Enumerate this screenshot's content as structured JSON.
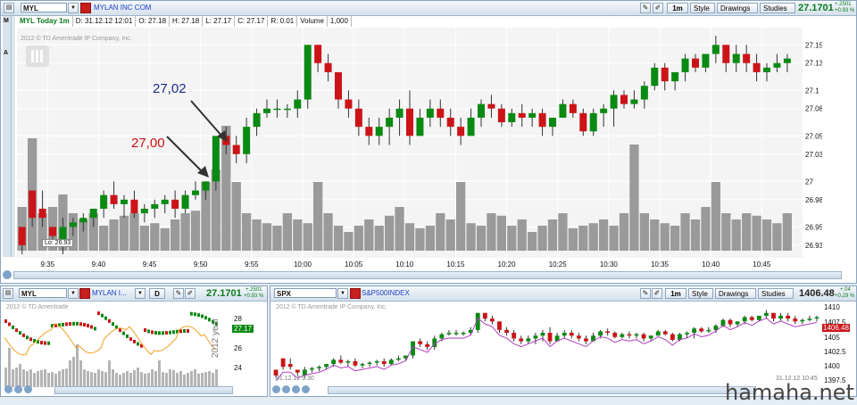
{
  "main": {
    "symbol": "MYL",
    "company_link": "MYLAN INC COM",
    "buttons": {
      "period": "1m",
      "style": "Style",
      "drawings": "Drawings",
      "studies": "Studies"
    },
    "last_price": "27.1701",
    "change_top": "+.2501",
    "change_bottom": "+0.93 %",
    "info": {
      "title": "MYL Today 1m",
      "date": "D: 31.12.12 12:01",
      "open": "O: 27.18",
      "high": "H: 27.18",
      "low": "L: 27.17",
      "close": "C: 27.17",
      "range": "R: 0.01",
      "volume_label": "Volume",
      "volume_value": "1,000"
    },
    "copyright": "2012 © TD Ameritrade IP Company, Inc.",
    "lo_label": "Lo: 26.93",
    "annotations": {
      "upper": "27,02",
      "lower": "27,00"
    },
    "side_letters": [
      "M",
      "A"
    ]
  },
  "chart_data": {
    "type": "candlestick",
    "title": "MYL Today 1m",
    "x_ticks": [
      "9:35",
      "9:40",
      "9:45",
      "9:50",
      "9:55",
      "10:00",
      "10:05",
      "10:10",
      "10:15",
      "10:20",
      "10:25",
      "10:30",
      "10:35",
      "10:40",
      "10:45"
    ],
    "y_ticks": [
      "27.15",
      "27.13",
      "27.1",
      "27.08",
      "27.05",
      "27.03",
      "27",
      "26.98",
      "26.95",
      "26.93"
    ],
    "y_range": [
      26.92,
      27.165
    ],
    "candles_ohlc": [
      [
        26.95,
        26.95,
        26.92,
        26.93
      ],
      [
        26.99,
        26.99,
        26.95,
        26.96
      ],
      [
        26.97,
        26.99,
        26.95,
        26.96
      ],
      [
        26.95,
        26.95,
        26.93,
        26.94
      ],
      [
        26.93,
        26.96,
        26.92,
        26.95
      ],
      [
        26.95,
        26.96,
        26.94,
        26.955
      ],
      [
        26.955,
        26.965,
        26.945,
        26.96
      ],
      [
        26.96,
        26.97,
        26.95,
        26.97
      ],
      [
        26.97,
        26.99,
        26.96,
        26.985
      ],
      [
        26.985,
        27.0,
        26.97,
        26.975
      ],
      [
        26.975,
        26.985,
        26.96,
        26.98
      ],
      [
        26.98,
        26.99,
        26.96,
        26.965
      ],
      [
        26.965,
        26.975,
        26.955,
        26.97
      ],
      [
        26.97,
        26.98,
        26.96,
        26.975
      ],
      [
        26.975,
        26.985,
        26.965,
        26.98
      ],
      [
        26.98,
        26.99,
        26.96,
        26.97
      ],
      [
        26.97,
        26.99,
        26.965,
        26.985
      ],
      [
        26.985,
        27.0,
        26.98,
        26.99
      ],
      [
        26.99,
        27.0,
        26.98,
        27.0
      ],
      [
        27.0,
        27.02,
        26.99,
        27.05
      ],
      [
        27.05,
        27.06,
        27.03,
        27.04
      ],
      [
        27.04,
        27.05,
        27.02,
        27.03
      ],
      [
        27.03,
        27.07,
        27.02,
        27.06
      ],
      [
        27.06,
        27.08,
        27.05,
        27.075
      ],
      [
        27.075,
        27.09,
        27.07,
        27.08
      ],
      [
        27.08,
        27.09,
        27.07,
        27.08
      ],
      [
        27.08,
        27.085,
        27.07,
        27.08
      ],
      [
        27.08,
        27.1,
        27.07,
        27.09
      ],
      [
        27.09,
        27.15,
        27.08,
        27.15
      ],
      [
        27.15,
        27.15,
        27.12,
        27.13
      ],
      [
        27.13,
        27.14,
        27.11,
        27.12
      ],
      [
        27.12,
        27.12,
        27.08,
        27.09
      ],
      [
        27.09,
        27.1,
        27.07,
        27.08
      ],
      [
        27.08,
        27.09,
        27.05,
        27.06
      ],
      [
        27.06,
        27.07,
        27.04,
        27.05
      ],
      [
        27.05,
        27.07,
        27.04,
        27.06
      ],
      [
        27.06,
        27.08,
        27.04,
        27.07
      ],
      [
        27.07,
        27.09,
        27.05,
        27.08
      ],
      [
        27.08,
        27.1,
        27.04,
        27.05
      ],
      [
        27.05,
        27.08,
        27.05,
        27.07
      ],
      [
        27.07,
        27.09,
        27.06,
        27.08
      ],
      [
        27.08,
        27.09,
        27.06,
        27.07
      ],
      [
        27.07,
        27.08,
        27.05,
        27.06
      ],
      [
        27.06,
        27.07,
        27.04,
        27.05
      ],
      [
        27.05,
        27.08,
        27.05,
        27.07
      ],
      [
        27.07,
        27.09,
        27.06,
        27.085
      ],
      [
        27.085,
        27.095,
        27.07,
        27.08
      ],
      [
        27.08,
        27.085,
        27.06,
        27.065
      ],
      [
        27.065,
        27.08,
        27.06,
        27.075
      ],
      [
        27.075,
        27.085,
        27.06,
        27.07
      ],
      [
        27.07,
        27.08,
        27.06,
        27.075
      ],
      [
        27.075,
        27.08,
        27.05,
        27.06
      ],
      [
        27.06,
        27.07,
        27.05,
        27.07
      ],
      [
        27.07,
        27.09,
        27.07,
        27.085
      ],
      [
        27.085,
        27.09,
        27.07,
        27.075
      ],
      [
        27.075,
        27.08,
        27.05,
        27.055
      ],
      [
        27.055,
        27.08,
        27.05,
        27.075
      ],
      [
        27.075,
        27.085,
        27.06,
        27.08
      ],
      [
        27.08,
        27.1,
        27.06,
        27.095
      ],
      [
        27.095,
        27.1,
        27.08,
        27.085
      ],
      [
        27.085,
        27.1,
        27.08,
        27.09
      ],
      [
        27.09,
        27.11,
        27.08,
        27.105
      ],
      [
        27.105,
        27.13,
        27.1,
        27.125
      ],
      [
        27.125,
        27.13,
        27.1,
        27.11
      ],
      [
        27.11,
        27.12,
        27.1,
        27.12
      ],
      [
        27.12,
        27.14,
        27.11,
        27.135
      ],
      [
        27.135,
        27.14,
        27.12,
        27.125
      ],
      [
        27.125,
        27.14,
        27.12,
        27.14
      ],
      [
        27.14,
        27.16,
        27.13,
        27.15
      ],
      [
        27.15,
        27.15,
        27.12,
        27.13
      ],
      [
        27.13,
        27.15,
        27.12,
        27.14
      ],
      [
        27.14,
        27.15,
        27.12,
        27.13
      ],
      [
        27.13,
        27.14,
        27.11,
        27.12
      ],
      [
        27.12,
        27.13,
        27.11,
        27.125
      ],
      [
        27.125,
        27.14,
        27.12,
        27.13
      ],
      [
        27.13,
        27.14,
        27.12,
        27.135
      ]
    ],
    "volume_relative": [
      0.35,
      0.9,
      0.3,
      0.35,
      0.45,
      0.3,
      0.25,
      0.3,
      0.2,
      0.25,
      0.28,
      0.3,
      0.2,
      0.22,
      0.18,
      0.25,
      0.3,
      0.32,
      0.55,
      0.65,
      1.0,
      0.55,
      0.3,
      0.25,
      0.22,
      0.2,
      0.3,
      0.25,
      0.22,
      0.55,
      0.3,
      0.2,
      0.15,
      0.2,
      0.25,
      0.2,
      0.28,
      0.35,
      0.22,
      0.18,
      0.2,
      0.3,
      0.25,
      0.55,
      0.22,
      0.2,
      0.3,
      0.28,
      0.2,
      0.25,
      0.15,
      0.2,
      0.25,
      0.3,
      0.18,
      0.2,
      0.22,
      0.25,
      0.2,
      0.3,
      0.85,
      0.3,
      0.25,
      0.22,
      0.2,
      0.3,
      0.25,
      0.35,
      0.55,
      0.3,
      0.25,
      0.3,
      0.28,
      0.25,
      0.22,
      0.3
    ]
  },
  "lower_left": {
    "symbol": "MYL",
    "company_link": "MYLAN I...",
    "period": "D",
    "last_price": "27.1701",
    "change_top": "+.2501",
    "change_bottom": "+0.93 %",
    "copyright": "2012 © TD Ameritrade",
    "y_ticks": [
      "28",
      "26",
      "24"
    ],
    "price_badge": "27.17",
    "vertical_text": "2012 year"
  },
  "lower_right": {
    "symbol": "SPX",
    "index_link": "S&P500INDEX",
    "buttons": {
      "period": "1m",
      "style": "Style",
      "drawings": "Drawings",
      "studies": "Studies"
    },
    "last_price": "1406.48",
    "change_top": "+.04",
    "change_bottom": "+0.29 %",
    "copyright": "2012 © TD Ameritrade IP Company, Inc.",
    "y_ticks": [
      "1410",
      "1407.5",
      "1405",
      "1402.5",
      "1400",
      "1397.5"
    ],
    "price_badge": "1406.48",
    "date_left": "31.12.12 9:30",
    "date_right": "31.12.12 10:45"
  },
  "watermark": "hamaha.net",
  "colors": {
    "up": "#0a8a12",
    "down": "#cc1418",
    "volume": "#9a9a9a",
    "annot_blue": "#1e2a8c",
    "annot_red": "#cc1111",
    "accent": "#0a7a1a"
  }
}
